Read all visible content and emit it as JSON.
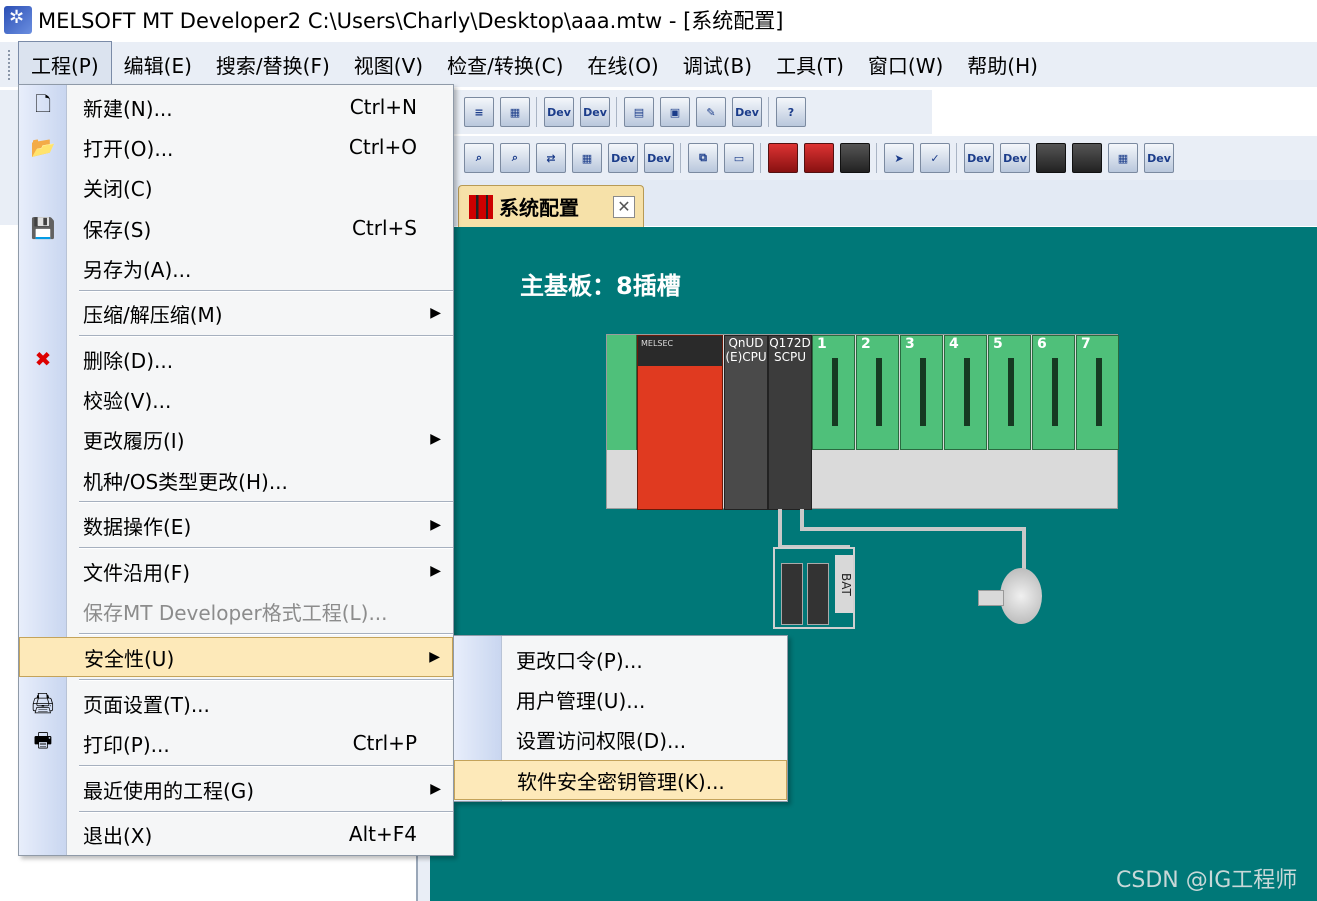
{
  "window": {
    "title": "MELSOFT MT Developer2 C:\\Users\\Charly\\Desktop\\aaa.mtw - [系统配置]"
  },
  "menubar": {
    "items": [
      "工程(P)",
      "编辑(E)",
      "搜索/替换(F)",
      "视图(V)",
      "检查/转换(C)",
      "在线(O)",
      "调试(B)",
      "工具(T)",
      "窗口(W)",
      "帮助(H)"
    ],
    "active": "工程(P)"
  },
  "project_menu": {
    "items": [
      {
        "label": "新建(N)...",
        "shortcut": "Ctrl+N",
        "icon": "new-document-icon"
      },
      {
        "label": "打开(O)...",
        "shortcut": "Ctrl+O",
        "icon": "open-folder-icon"
      },
      {
        "label": "关闭(C)"
      },
      {
        "label": "保存(S)",
        "shortcut": "Ctrl+S",
        "icon": "save-disk-icon"
      },
      {
        "label": "另存为(A)..."
      },
      {
        "label": "压缩/解压缩(M)",
        "submenu": true
      },
      {
        "label": "删除(D)...",
        "icon": "delete-icon"
      },
      {
        "label": "校验(V)..."
      },
      {
        "label": "更改履历(I)",
        "submenu": true
      },
      {
        "label": "机种/OS类型更改(H)..."
      },
      {
        "label": "数据操作(E)",
        "submenu": true
      },
      {
        "label": "文件沿用(F)",
        "submenu": true
      },
      {
        "label": "保存MT Developer格式工程(L)...",
        "disabled": true
      },
      {
        "label": "安全性(U)",
        "submenu": true,
        "highlighted": true
      },
      {
        "label": "页面设置(T)...",
        "icon": "page-setup-icon"
      },
      {
        "label": "打印(P)...",
        "shortcut": "Ctrl+P",
        "icon": "printer-icon"
      },
      {
        "label": "最近使用的工程(G)",
        "submenu": true
      },
      {
        "label": "退出(X)",
        "shortcut": "Alt+F4"
      }
    ]
  },
  "security_submenu": {
    "items": [
      "更改口令(P)...",
      "用户管理(U)...",
      "设置访问权限(D)...",
      "软件安全密钥管理(K)..."
    ],
    "highlighted": "软件安全密钥管理(K)..."
  },
  "doc_tab": {
    "label": "系统配置"
  },
  "workspace": {
    "base_title": "主基板：8插槽",
    "modules": {
      "cpu1": [
        "QnUD",
        "(E)CPU"
      ],
      "cpu2": [
        "Q172D",
        "SCPU"
      ],
      "slots": [
        "1",
        "2",
        "3",
        "4",
        "5",
        "6",
        "7"
      ],
      "cpu_brand": "MELSEC"
    },
    "battery_label": "BAT"
  },
  "toolbar": {
    "dev_label": "Dev"
  },
  "watermark": "CSDN @IG工程师",
  "colors": {
    "workspace_bg": "#007878",
    "menu_highlight": "#fde9b9",
    "tab_active": "#f6e1a9",
    "module_green": "#4fc07a",
    "cpu_red": "#e03a20"
  }
}
